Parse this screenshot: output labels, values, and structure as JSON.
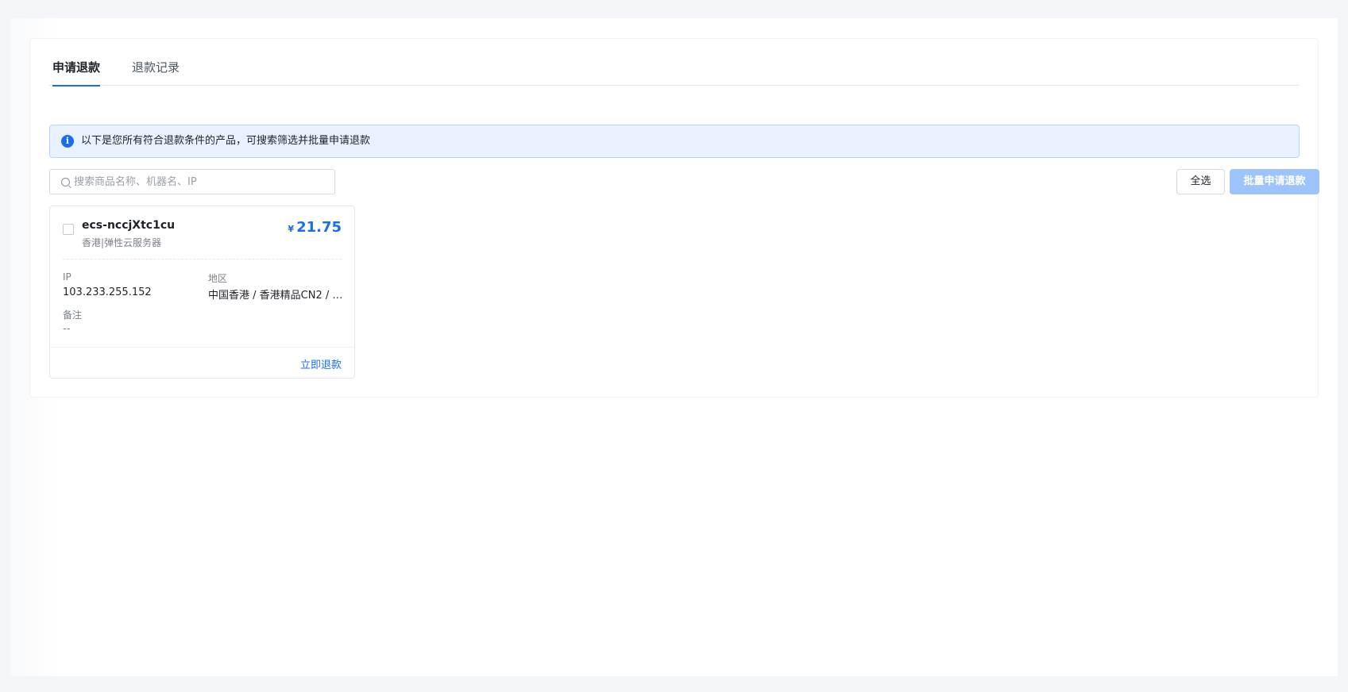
{
  "tabs": [
    {
      "label": "申请退款",
      "active": true
    },
    {
      "label": "退款记录",
      "active": false
    }
  ],
  "alert": {
    "icon": "info-icon",
    "text": "以下是您所有符合退款条件的产品，可搜索筛选并批量申请退款"
  },
  "search": {
    "icon": "search-icon",
    "placeholder": "搜索商品名称、机器名、IP",
    "value": ""
  },
  "actions": {
    "select_all_label": "全选",
    "batch_refund_label": "批量申请退款"
  },
  "products": [
    {
      "name": "ecs-nccjXtc1cu",
      "subtitle": "香港|弹性云服务器",
      "currency": "¥",
      "price": "21.75",
      "ip_label": "IP",
      "ip": "103.233.255.152",
      "region_label": "地区",
      "region": "中国香港 / 香港精品CN2 / …",
      "note_label": "备注",
      "note": "--",
      "refund_label": "立即退款",
      "checked": false
    }
  ],
  "colors": {
    "accent": "#1a6cf0",
    "alert_bg": "#e8f2fe",
    "disabled_button": "#9cc4fb"
  }
}
